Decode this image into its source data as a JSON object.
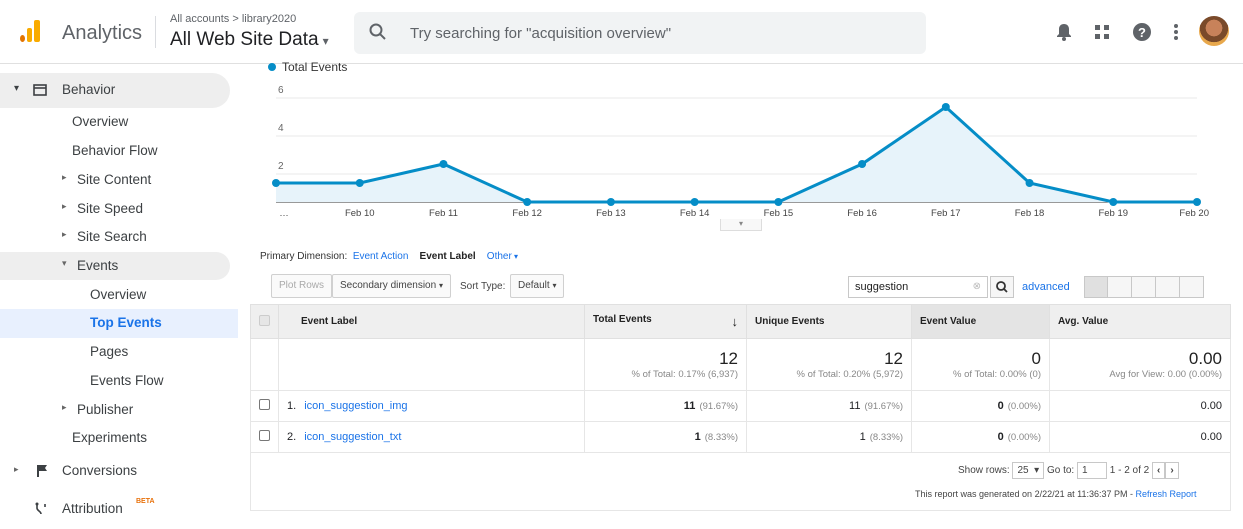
{
  "header": {
    "app_name": "Analytics",
    "account_path": "All accounts > library2020",
    "view_name": "All Web Site Data",
    "search_placeholder": "Try searching for \"acquisition overview\""
  },
  "sidebar": {
    "behavior": "Behavior",
    "overview": "Overview",
    "behavior_flow": "Behavior Flow",
    "site_content": "Site Content",
    "site_speed": "Site Speed",
    "site_search": "Site Search",
    "events": "Events",
    "events_overview": "Overview",
    "top_events": "Top Events",
    "pages": "Pages",
    "events_flow": "Events Flow",
    "publisher": "Publisher",
    "experiments": "Experiments",
    "conversions": "Conversions",
    "attribution": "Attribution",
    "beta": "BETA"
  },
  "colors": {
    "accent": "#1a73e8",
    "series": "#058dc7",
    "orange": "#f9ab00"
  },
  "chart_data": {
    "type": "line",
    "legend": [
      "Total Events"
    ],
    "x": [
      "…",
      "Feb 10",
      "Feb 11",
      "Feb 12",
      "Feb 13",
      "Feb 14",
      "Feb 15",
      "Feb 16",
      "Feb 17",
      "Feb 18",
      "Feb 19",
      "Feb 20"
    ],
    "series": [
      {
        "name": "Total Events",
        "values": [
          1,
          1,
          2,
          0,
          0,
          0,
          0,
          2,
          5,
          1,
          0,
          0
        ]
      }
    ],
    "yticks": [
      "2",
      "4",
      "6"
    ],
    "ylim": [
      0,
      6
    ]
  },
  "dimension": {
    "label": "Primary Dimension:",
    "event_action": "Event Action",
    "event_label": "Event Label",
    "other": "Other"
  },
  "controls": {
    "plot_rows": "Plot Rows",
    "secondary": "Secondary dimension",
    "sort_type_label": "Sort Type:",
    "sort_type": "Default",
    "search_value": "suggestion",
    "advanced": "advanced"
  },
  "table": {
    "headers": [
      "Event Label",
      "Total Events",
      "Unique Events",
      "Event Value",
      "Avg. Value"
    ],
    "totals": {
      "total_events": "12",
      "total_events_sub": "% of Total: 0.17% (6,937)",
      "unique_events": "12",
      "unique_events_sub": "% of Total: 0.20% (5,972)",
      "event_value": "0",
      "event_value_sub": "% of Total: 0.00% (0)",
      "avg_value": "0.00",
      "avg_value_sub": "Avg for View: 0.00 (0.00%)"
    },
    "rows": [
      {
        "idx": "1.",
        "label": "icon_suggestion_img",
        "total": "11",
        "total_pct": "(91.67%)",
        "unique": "11",
        "unique_pct": "(91.67%)",
        "value": "0",
        "value_pct": "(0.00%)",
        "avg": "0.00"
      },
      {
        "idx": "2.",
        "label": "icon_suggestion_txt",
        "total": "1",
        "total_pct": "(8.33%)",
        "unique": "1",
        "unique_pct": "(8.33%)",
        "value": "0",
        "value_pct": "(0.00%)",
        "avg": "0.00"
      }
    ]
  },
  "pager": {
    "show_rows": "Show rows:",
    "rows_value": "25",
    "goto": "Go to:",
    "goto_value": "1",
    "range": "1 - 2 of 2"
  },
  "report_note": "This report was generated on 2/22/21 at 11:36:37 PM - ",
  "refresh": "Refresh Report"
}
